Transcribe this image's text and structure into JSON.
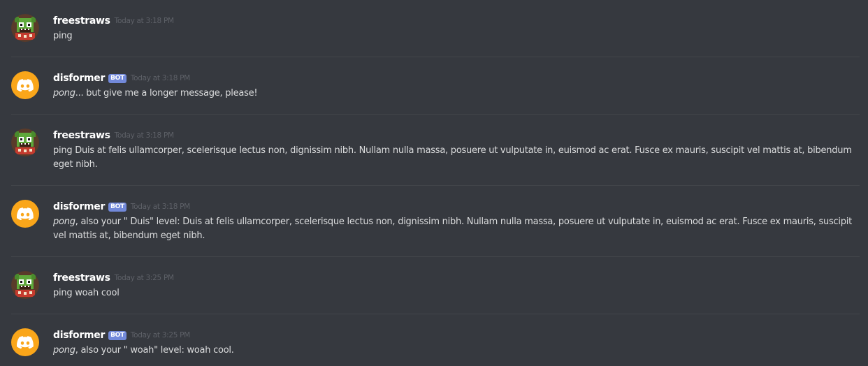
{
  "messages": [
    {
      "author": "freestraws",
      "is_bot": false,
      "timestamp": "Today at 3:18 PM",
      "emphasis": "",
      "text": "ping"
    },
    {
      "author": "disformer",
      "is_bot": true,
      "bot_label": "BOT",
      "timestamp": "Today at 3:18 PM",
      "emphasis": "pong",
      "text": "... but give me a longer message, please!"
    },
    {
      "author": "freestraws",
      "is_bot": false,
      "timestamp": "Today at 3:18 PM",
      "emphasis": "",
      "text": "ping Duis at felis ullamcorper, scelerisque lectus non, dignissim nibh. Nullam nulla massa, posuere ut vulputate in, euismod ac erat. Fusce ex mauris, suscipit vel mattis at, bibendum eget nibh."
    },
    {
      "author": "disformer",
      "is_bot": true,
      "bot_label": "BOT",
      "timestamp": "Today at 3:18 PM",
      "emphasis": "pong",
      "text": ", also your \" Duis\" level:  Duis at felis ullamcorper, scelerisque lectus non, dignissim nibh. Nullam nulla massa, posuere ut vulputate in, euismod ac erat. Fusce ex mauris, suscipit vel mattis at, bibendum eget nibh."
    },
    {
      "author": "freestraws",
      "is_bot": false,
      "timestamp": "Today at 3:25 PM",
      "emphasis": "",
      "text": "ping woah cool"
    },
    {
      "author": "disformer",
      "is_bot": true,
      "bot_label": "BOT",
      "timestamp": "Today at 3:25 PM",
      "emphasis": "pong",
      "text": ", also your \" woah\" level:  woah cool."
    }
  ],
  "colors": {
    "background": "#36393f",
    "divider": "#42454a",
    "bot_tag": "#7289da",
    "discord_avatar": "#faa61a",
    "username": "#ffffff",
    "message_text": "#dcddde",
    "timestamp": "#5e6168"
  },
  "icons": {
    "user_avatar": "pixel-monster-avatar-icon",
    "bot_avatar": "discord-logo-icon"
  }
}
